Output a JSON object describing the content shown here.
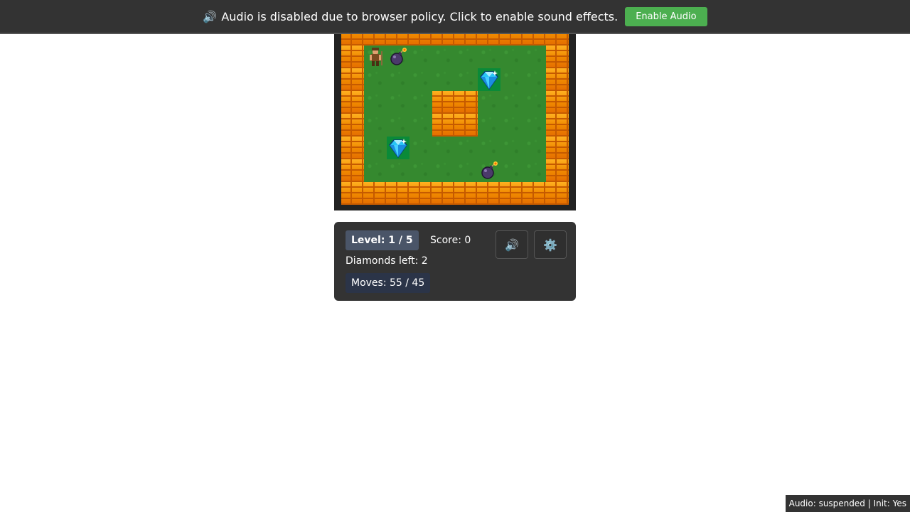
{
  "banner": {
    "icon": "speaker-icon",
    "icon_glyph": "🔊",
    "message": "Audio is disabled due to browser policy. Click to enable sound effects.",
    "button_label": "Enable Audio",
    "button_color": "#4caf50"
  },
  "board": {
    "cols": 10,
    "rows": 8,
    "legend": {
      "W": "brick-wall",
      "G": "grass",
      "P": "player",
      "B": "bomb",
      "D": "diamond"
    },
    "grid": [
      "WWWWWWWWWW",
      "WPBGGGGGGW",
      "WGGGGGDGGW",
      "WGGGWWGGGW",
      "WGGGWWGGGW",
      "WGDGGGGGGW",
      "WGGGGGBGGW",
      "WWWWWWWWWW"
    ],
    "colors": {
      "wall": "#f08a00",
      "grass": "#35892f",
      "diamond_tile": "#0a8a38",
      "diamond": "#29c5f6",
      "bomb": "#4b3a6b"
    }
  },
  "hud": {
    "level_label": "Level: 1 / 5",
    "score_label": "Score: 0",
    "diamonds_label": "Diamonds left: 2",
    "moves_label": "Moves: 55 / 45",
    "sound_icon": "speaker-icon",
    "sound_glyph": "🔊",
    "settings_icon": "gear-icon",
    "settings_glyph": "⚙️"
  },
  "status": {
    "text": "Audio: suspended | Init: Yes"
  }
}
